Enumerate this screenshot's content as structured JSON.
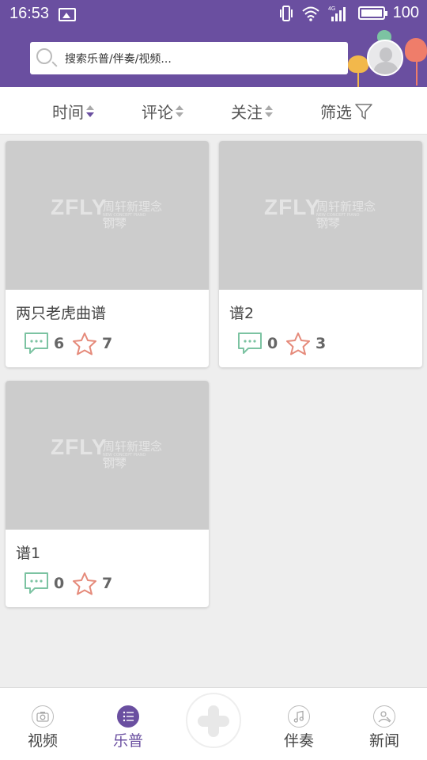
{
  "status_bar": {
    "time": "16:53",
    "battery": "100",
    "network": "4G"
  },
  "search": {
    "placeholder": "搜索乐普/伴奏/视频..."
  },
  "filters": [
    {
      "label": "时间",
      "active": true
    },
    {
      "label": "评论",
      "active": false
    },
    {
      "label": "关注",
      "active": false
    },
    {
      "label": "筛选",
      "active": false
    }
  ],
  "watermark": {
    "logo": "ZFLY",
    "chinese": "周轩新理念钢琴",
    "sub": "NEW CONCEPT PIANO EDUCATION"
  },
  "cards": [
    {
      "title": "两只老虎曲谱",
      "comments": "6",
      "stars": "7"
    },
    {
      "title": "谱2",
      "comments": "0",
      "stars": "3"
    },
    {
      "title": "谱1",
      "comments": "0",
      "stars": "7"
    }
  ],
  "nav": [
    {
      "label": "视频",
      "icon": "camera-icon",
      "active": false
    },
    {
      "label": "乐普",
      "icon": "list-icon",
      "active": true
    },
    {
      "label": "伴奏",
      "icon": "music-note-icon",
      "active": false
    },
    {
      "label": "新闻",
      "icon": "news-icon",
      "active": false
    }
  ],
  "colors": {
    "primary": "#6a4fa0",
    "comment_icon": "#7cc3a2",
    "star_icon": "#e58a7a",
    "thumbnail": "#cccccc"
  }
}
